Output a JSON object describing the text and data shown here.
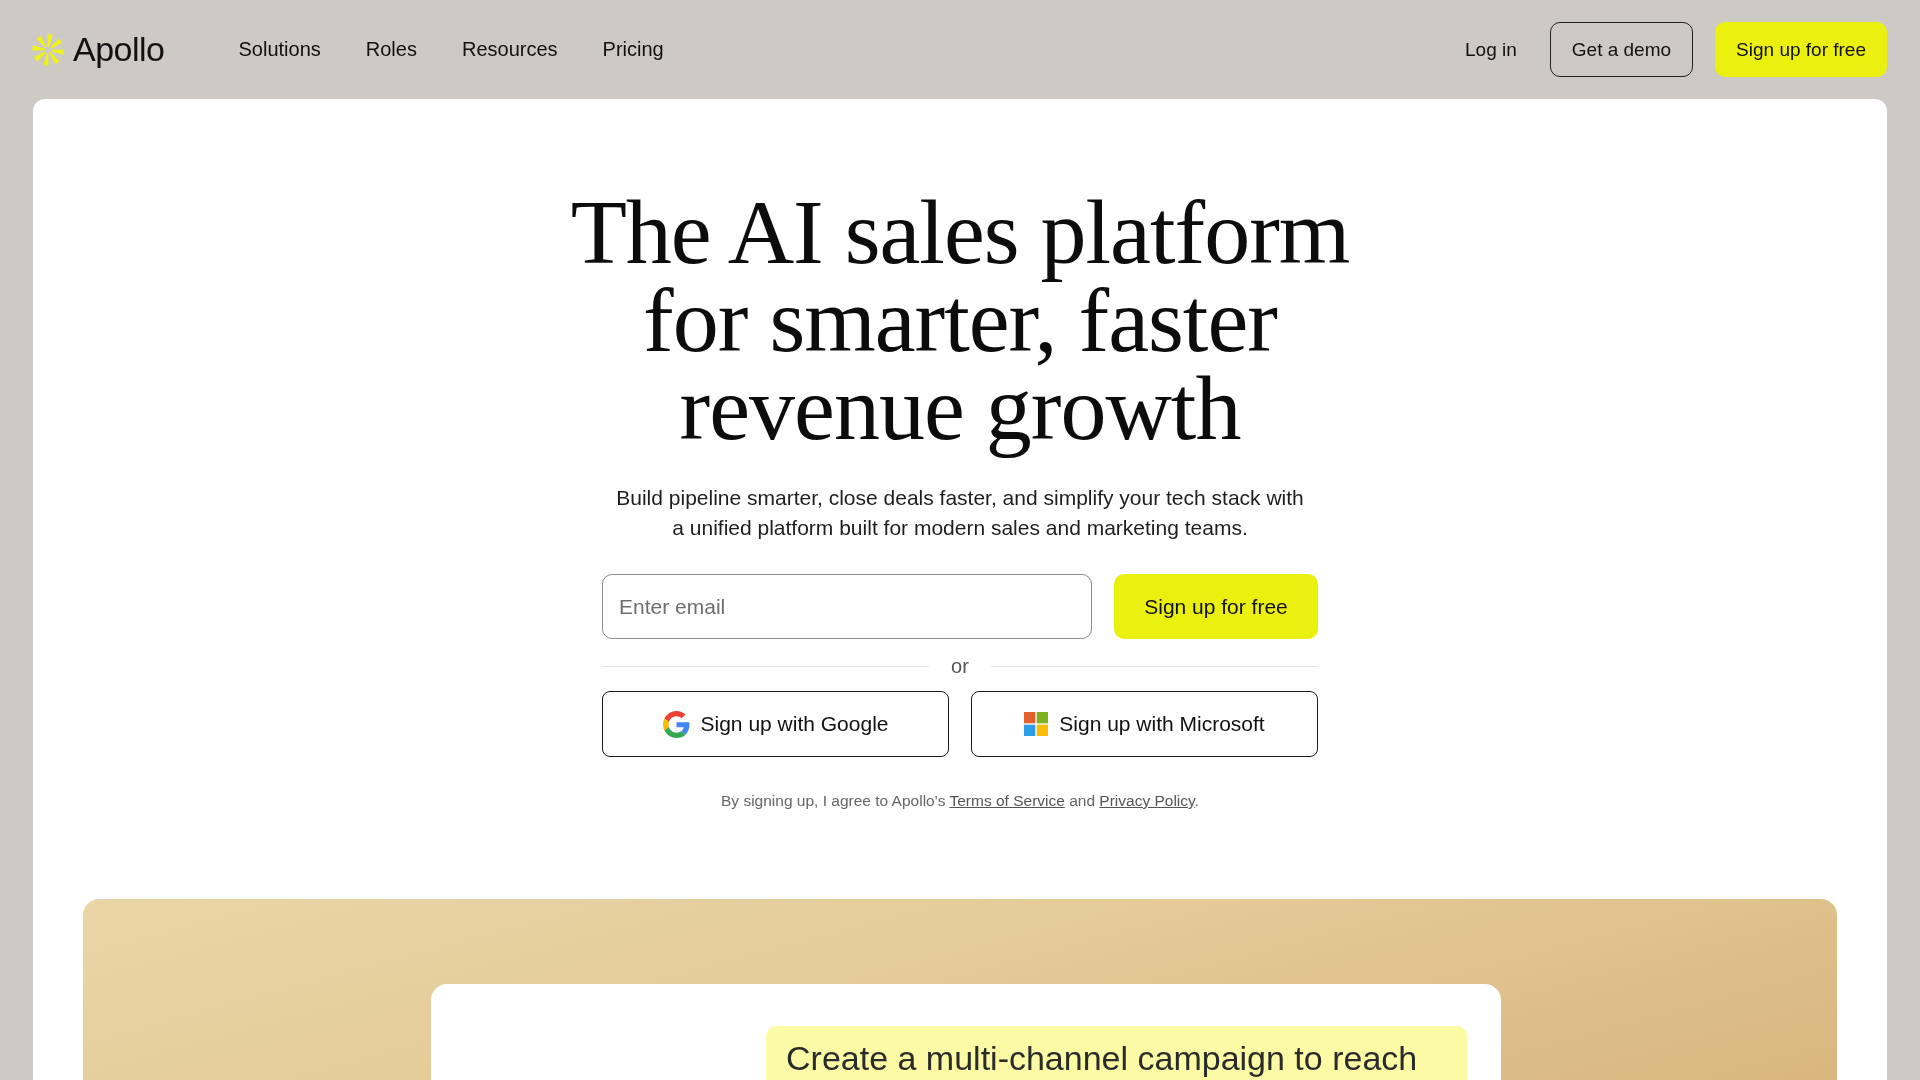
{
  "header": {
    "logo": "Apollo",
    "nav": [
      "Solutions",
      "Roles",
      "Resources",
      "Pricing"
    ],
    "actions": [
      {
        "label": "Log in",
        "kind": "link"
      },
      {
        "label": "Get a demo",
        "kind": "outline"
      },
      {
        "label": "Sign up for free",
        "kind": "primary"
      }
    ]
  },
  "hero": {
    "title": "The AI sales platform for smarter, faster revenue growth",
    "subtitle": "Build pipeline smarter, close deals faster, and simplify your tech stack with a unified platform built for modern sales and marketing teams.",
    "email": {
      "placeholder": "Enter email"
    },
    "submit": "Sign up for free",
    "divider": "or",
    "social": [
      {
        "label": "Sign up with Google",
        "kind": "google"
      },
      {
        "label": "Sign up with Microsoft",
        "kind": "microsoft"
      }
    ],
    "terms": [
      {
        "text": "By signing up, I agree to Apollo's ",
        "kind": "text"
      },
      {
        "text": "Terms of Service",
        "kind": "link"
      },
      {
        "text": " and ",
        "kind": "text"
      },
      {
        "text": "Privacy Policy",
        "kind": "link"
      },
      {
        "text": ".",
        "kind": "text"
      }
    ]
  },
  "preview": {
    "prompt": "Create a multi-channel campaign to reach"
  }
}
